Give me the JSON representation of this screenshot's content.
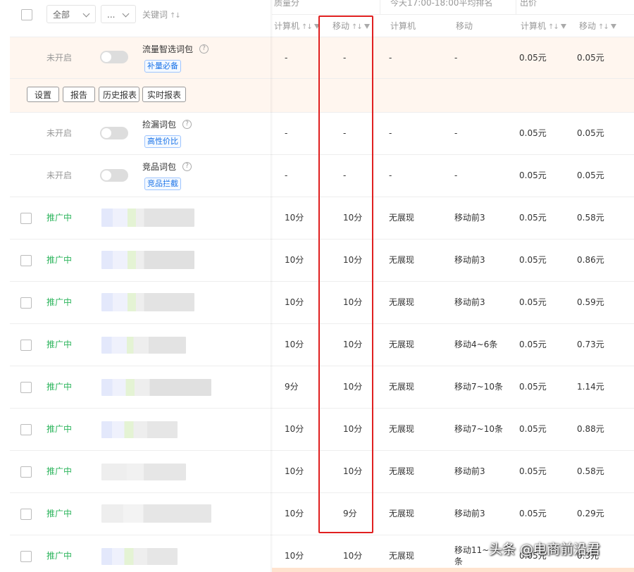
{
  "header": {
    "filter_all": "全部",
    "filter_more": "...",
    "keyword": "关键词",
    "group_quality": "质量分",
    "group_rank": "今天17:00-18:00平均排名",
    "group_bid": "出价",
    "q_pc": "计算机",
    "q_mobile": "移动",
    "r_pc": "计算机",
    "r_mobile": "移动",
    "b_pc": "计算机",
    "b_mobile": "移动"
  },
  "package_rows": [
    {
      "status": "未开启",
      "name": "流量智选词包",
      "tag": "补量必备",
      "q_pc": "-",
      "q_mobile": "-",
      "r_pc": "-",
      "r_mobile": "-",
      "b_pc": "0.05元",
      "b_mobile": "0.05元"
    },
    {
      "status": "未开启",
      "name": "捡漏词包",
      "tag": "高性价比",
      "q_pc": "-",
      "q_mobile": "-",
      "r_pc": "-",
      "r_mobile": "-",
      "b_pc": "0.05元",
      "b_mobile": "0.05元"
    },
    {
      "status": "未开启",
      "name": "竞品词包",
      "tag": "竞品拦截",
      "q_pc": "-",
      "q_mobile": "-",
      "r_pc": "-",
      "r_mobile": "-",
      "b_pc": "0.05元",
      "b_mobile": "0.05元"
    }
  ],
  "actions": [
    "设置",
    "报告",
    "历史报表",
    "实时报表"
  ],
  "keyword_rows": [
    {
      "status": "推广中",
      "q_pc": "10分",
      "q_mobile": "10分",
      "r_pc": "无展现",
      "r_mobile": "移动前3",
      "b_pc": "0.05元",
      "b_mobile": "0.58元"
    },
    {
      "status": "推广中",
      "q_pc": "10分",
      "q_mobile": "10分",
      "r_pc": "无展现",
      "r_mobile": "移动前3",
      "b_pc": "0.05元",
      "b_mobile": "0.86元"
    },
    {
      "status": "推广中",
      "q_pc": "10分",
      "q_mobile": "10分",
      "r_pc": "无展现",
      "r_mobile": "移动前3",
      "b_pc": "0.05元",
      "b_mobile": "0.59元"
    },
    {
      "status": "推广中",
      "q_pc": "10分",
      "q_mobile": "10分",
      "r_pc": "无展现",
      "r_mobile": "移动4~6条",
      "b_pc": "0.05元",
      "b_mobile": "0.73元"
    },
    {
      "status": "推广中",
      "q_pc": "9分",
      "q_mobile": "10分",
      "r_pc": "无展现",
      "r_mobile": "移动7~10条",
      "b_pc": "0.05元",
      "b_mobile": "1.14元"
    },
    {
      "status": "推广中",
      "q_pc": "10分",
      "q_mobile": "10分",
      "r_pc": "无展现",
      "r_mobile": "移动7~10条",
      "b_pc": "0.05元",
      "b_mobile": "0.88元"
    },
    {
      "status": "推广中",
      "q_pc": "10分",
      "q_mobile": "10分",
      "r_pc": "无展现",
      "r_mobile": "移动前3",
      "b_pc": "0.05元",
      "b_mobile": "0.58元"
    },
    {
      "status": "推广中",
      "q_pc": "10分",
      "q_mobile": "9分",
      "r_pc": "无展现",
      "r_mobile": "移动前3",
      "b_pc": "0.05元",
      "b_mobile": "0.29元"
    },
    {
      "status": "推广中",
      "q_pc": "10分",
      "q_mobile": "10分",
      "r_pc": "无展现",
      "r_mobile": "移动11~",
      "r_mobile_2": "条",
      "b_pc": "0.05元",
      "b_mobile": "0.3元"
    }
  ],
  "watermark": "头条 @电商前沿君",
  "colors": {
    "highlight_border": "#e02020",
    "active_status": "#2db55d",
    "tag_blue": "#1a73e8",
    "package_row_bg": "#fff6ef"
  }
}
